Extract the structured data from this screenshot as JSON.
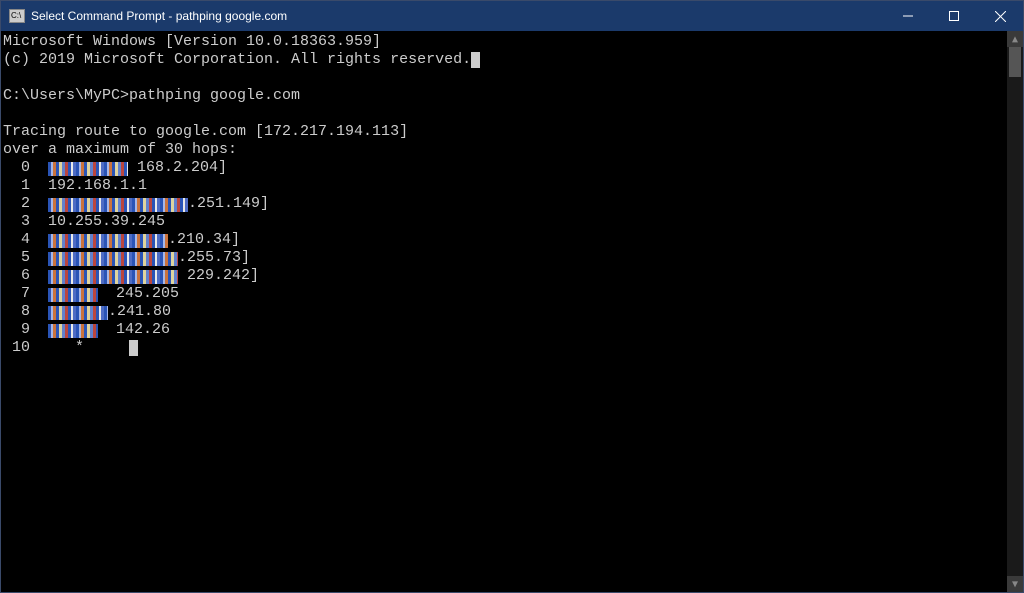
{
  "window": {
    "title": "Select Command Prompt - pathping  google.com"
  },
  "terminal": {
    "line1": "Microsoft Windows [Version 10.0.18363.959]",
    "line2": "(c) 2019 Microsoft Corporation. All rights reserved.",
    "prompt": "C:\\Users\\MyPC>",
    "command": "pathping google.com",
    "trace1": "Tracing route to google.com [172.217.194.113]",
    "trace2": "over a maximum of 30 hops:",
    "hops": [
      {
        "n": "  0  ",
        "pixw": 80,
        "tail": " 168.2.204]"
      },
      {
        "n": "  1  ",
        "pixw": 0,
        "tail": "192.168.1.1"
      },
      {
        "n": "  2  ",
        "pixw": 140,
        "tail": ".251.149]"
      },
      {
        "n": "  3  ",
        "pixw": 0,
        "tail": "10.255.39.245"
      },
      {
        "n": "  4  ",
        "pixw": 120,
        "tail": ".210.34]"
      },
      {
        "n": "  5  ",
        "pixw": 130,
        "tail": ".255.73]"
      },
      {
        "n": "  6  ",
        "pixw": 130,
        "tail": " 229.242]"
      },
      {
        "n": "  7  ",
        "pixw": 50,
        "tail": "  245.205"
      },
      {
        "n": "  8  ",
        "pixw": 60,
        "tail": ".241.80"
      },
      {
        "n": "  9  ",
        "pixw": 50,
        "tail": "  142.26"
      },
      {
        "n": " 10  ",
        "pixw": 0,
        "tail": "   *     "
      }
    ]
  }
}
